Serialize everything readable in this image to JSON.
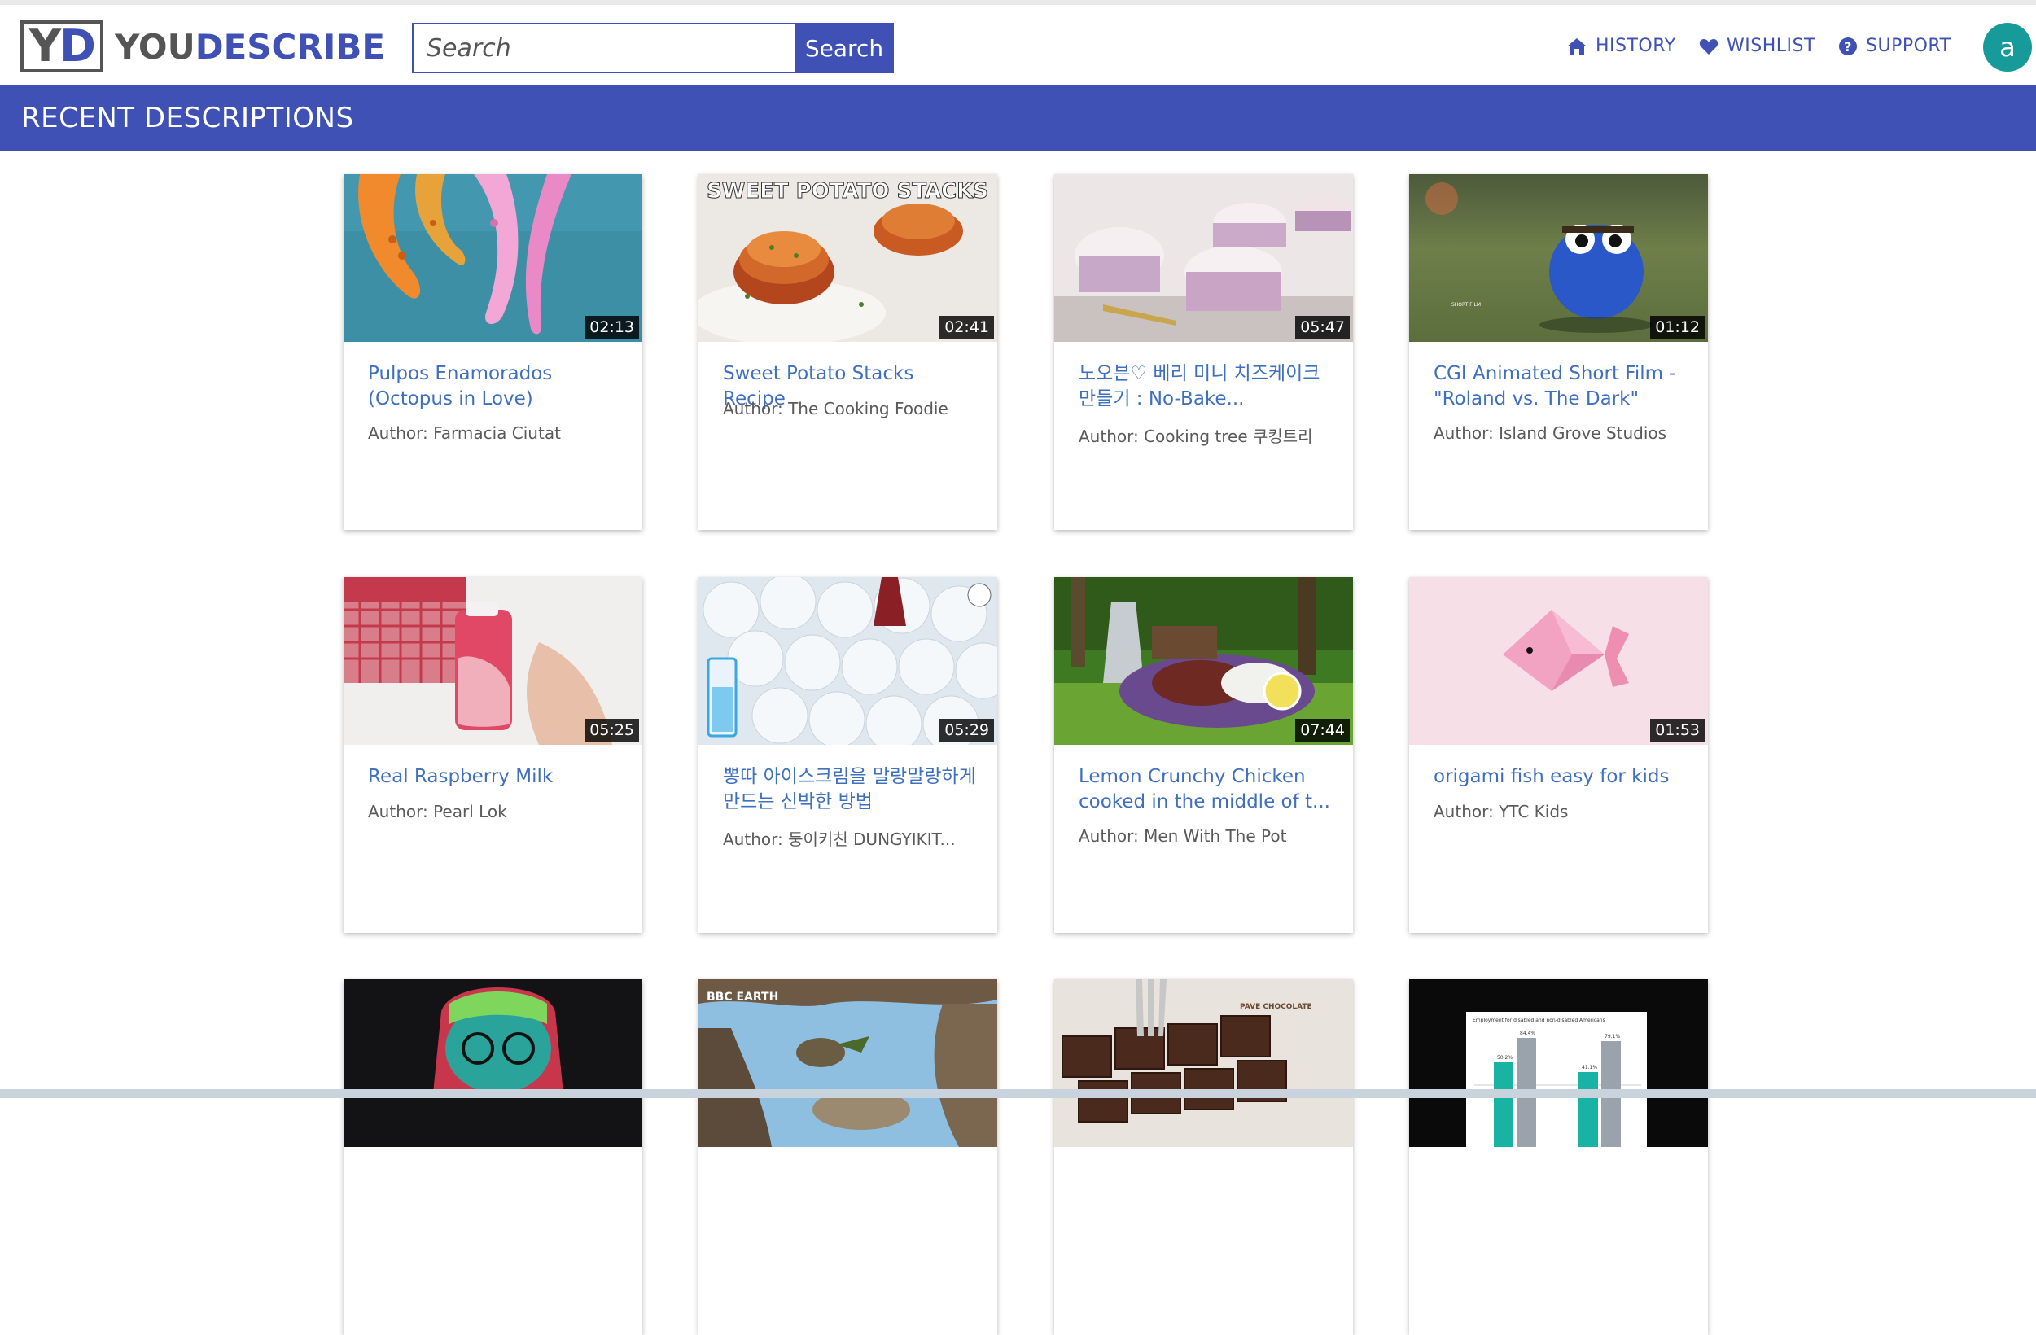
{
  "header": {
    "logo": {
      "mark_y": "Y",
      "mark_d": "D",
      "you": "YOU",
      "describe": "DESCRIBE"
    },
    "search": {
      "placeholder": "Search",
      "value": "",
      "button_label": "Search"
    },
    "nav": {
      "history": "HISTORY",
      "wishlist": "WISHLIST",
      "support": "SUPPORT"
    },
    "avatar_letter": "a"
  },
  "banner": {
    "title": "RECENT DESCRIPTIONS"
  },
  "colors": {
    "brand": "#3f51b5",
    "avatar": "#179a9a",
    "title_link": "#3f6fbf"
  },
  "videos": [
    {
      "title": "Pulpos Enamorados (Octopus in Love)",
      "author": "Author: Farmacia Ciutat",
      "duration": "02:13"
    },
    {
      "title": "Sweet Potato Stacks Recipe",
      "author": "Author: The Cooking Foodie",
      "duration": "02:41",
      "overlay": "SWEET POTATO STACKS"
    },
    {
      "title": "노오븐♡ 베리 미니 치즈케이크 만들기 : No-Bake...",
      "author": "Author: Cooking tree 쿠킹트리",
      "duration": "05:47"
    },
    {
      "title": "CGI Animated Short Film - \"Roland vs. The Dark\"",
      "author": "Author: Island Grove Studios",
      "duration": "01:12"
    },
    {
      "title": "Real Raspberry Milk",
      "author": "Author: Pearl Lok",
      "duration": "05:25"
    },
    {
      "title": "뽕따 아이스크림을 말랑말랑하게 만드는 신박한 방법",
      "author": "Author: 둥이키친 DUNGYIKIT...",
      "duration": "05:29"
    },
    {
      "title": "Lemon Crunchy Chicken cooked in the middle of t...",
      "author": "Author: Men With The Pot",
      "duration": "07:44"
    },
    {
      "title": "origami fish easy for kids",
      "author": "Author: YTC Kids",
      "duration": "01:53"
    },
    {
      "title": "",
      "author": "",
      "duration": ""
    },
    {
      "title": "",
      "author": "",
      "duration": "",
      "overlay": "BBC EARTH"
    },
    {
      "title": "",
      "author": "",
      "duration": "",
      "overlay": "PAVE CHOCOLATE"
    },
    {
      "title": "",
      "author": "",
      "duration": "",
      "overlay": "Employment for disabled and non-disabled Americans",
      "bar_labels": [
        "50.2%",
        "84.4%",
        "41.1%",
        "79.1%"
      ]
    }
  ]
}
